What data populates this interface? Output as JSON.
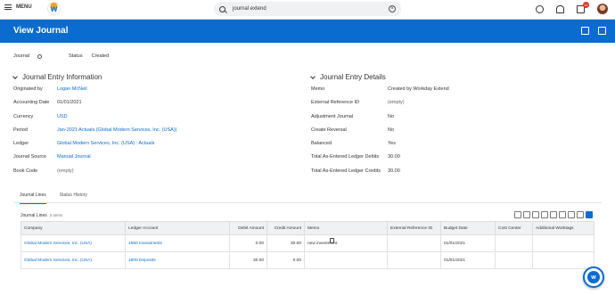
{
  "topbar": {
    "menu_label": "MENU",
    "search_value": "journal extend",
    "inbox_badge": "11"
  },
  "header": {
    "title": "View Journal"
  },
  "journal_bar": {
    "journal_label": "Journal",
    "status_label": "Status",
    "status_value": "Created"
  },
  "info": {
    "title": "Journal Entry Information",
    "rows": [
      {
        "k": "Originated by",
        "v": "Logan McNeil"
      },
      {
        "k": "Accounting Date",
        "v": "01/01/2021"
      },
      {
        "k": "Currency",
        "v": "USD"
      },
      {
        "k": "Period",
        "v": "Jan-2021 Actuals (Global Modern Services, Inc. (USA))"
      },
      {
        "k": "Ledger",
        "v": "Global Modern Services, Inc. (USA) : Actuals"
      },
      {
        "k": "Journal Source",
        "v": "Manual Journal"
      },
      {
        "k": "Book Code",
        "v": "(empty)"
      }
    ]
  },
  "details": {
    "title": "Journal Entry Details",
    "rows": [
      {
        "k": "Memo",
        "v": "Created by Workday Extend"
      },
      {
        "k": "External Reference ID",
        "v": "(empty)"
      },
      {
        "k": "Adjustment Journal",
        "v": "No"
      },
      {
        "k": "Create Reversal",
        "v": "No"
      },
      {
        "k": "Balanced",
        "v": "Yes"
      },
      {
        "k": "Total As-Entered Ledger Debits",
        "v": "30.00"
      },
      {
        "k": "Total As-Entered Ledger Credits",
        "v": "30.00"
      }
    ]
  },
  "tabs": [
    "Journal Lines",
    "Status History"
  ],
  "lines": {
    "title": "Journal Lines",
    "count": "2 items",
    "headers": [
      "Company",
      "Ledger Account",
      "Debit Amount",
      "Credit Amount",
      "Memo",
      "External Reference ID",
      "Budget Date",
      "Cost Center",
      "Additional Worktags"
    ],
    "rows": [
      [
        "Global Modern Services, Inc. (USA)",
        "1850 Investments",
        "0.00",
        "30.00",
        "new investment",
        "",
        "01/01/2021",
        "",
        ""
      ],
      [
        "Global Modern Services, Inc. (USA)",
        "1800 Deposits",
        "30.00",
        "0.00",
        "",
        "",
        "01/01/2021",
        "",
        ""
      ]
    ]
  }
}
